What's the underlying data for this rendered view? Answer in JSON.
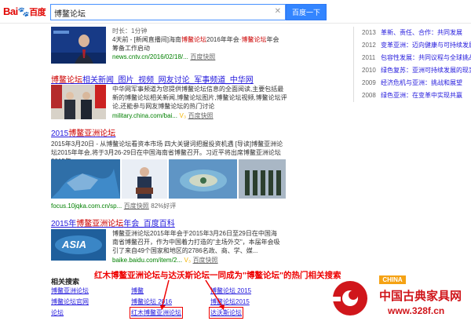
{
  "header": {
    "logo_text_bai": "Bai",
    "logo_text_du": "百度",
    "search_value": "博鳌论坛",
    "search_button": "百度一下"
  },
  "results": [
    {
      "meta_line": "时长：1分钟",
      "abstract_prefix": "4天前 - [新闻直播间]海南",
      "abstract_hl1": "博鳌论坛",
      "abstract_mid": "2016年年会·",
      "abstract_hl2": "博鳌论坛",
      "abstract_suffix": "年会筹备工作启动",
      "url": "news.cntv.cn/2016/02/18/...",
      "snapshot": "百度快照"
    },
    {
      "title_hl": "博鳌论坛",
      "title_rest": "相关新闻_图片_视频_网友讨论_军事频道_中华网",
      "abstract": "中华网军事频道为您提供博鳌论坛信息的全面阅读,主要包括最新的博鳌论坛相关新闻,博鳌论坛图片,博鳌论坛视频,博鳌论坛评论,还能参与网友博鳌论坛的热门讨论",
      "url": "military.china.com/bai...",
      "snapshot": "百度快照"
    },
    {
      "title_pre": "2015",
      "title_hl": "博鳌亚洲论坛",
      "abstract": "2015年3月20日 - 从博鳌论坛看资本市场 四大关键词把握投资机遇 [导读]博鳌亚洲论坛2015年年会,将于3月26-29日在中国海南省博鳌召开。习近平将出席博鳌亚洲论坛2015年...",
      "url": "focus.10jqka.com.cn/sp...",
      "snapshot": "百度快照",
      "rating": "82%好评"
    },
    {
      "title_pre": "2015年",
      "title_hl": "博鳌亚洲论坛",
      "title_rest": "年会_百度百科",
      "abstract": "博鳌亚洲论坛2015年年会于2015年3月26日至29日在中国海南省博鳌召开，作为中国着力打造的\"主场外交\"，本届年会吸引了来自49个国家和地区的2786名政、商、学、媒...",
      "url": "baike.baidu.com/item/2...",
      "snapshot": "百度快照",
      "thumb_text": "ASIA"
    }
  ],
  "timeline": [
    {
      "year": "2013",
      "title": "革新、责任、合作：共同发展"
    },
    {
      "year": "2012",
      "title": "变革亚洲：迈向健康与可持续发展"
    },
    {
      "year": "2011",
      "title": "包容性发展：共同议程与全球挑战"
    },
    {
      "year": "2010",
      "title": "绿色复苏：亚洲可持续发展的现实选择"
    },
    {
      "year": "2009",
      "title": "经济危机与亚洲：挑战和展望"
    },
    {
      "year": "2008",
      "title": "绿色亚洲：在变革中实现共赢"
    }
  ],
  "related": {
    "title": "相关搜索",
    "col1": [
      "博鳌亚洲论坛",
      "博鳌论坛官网",
      "论坛"
    ],
    "col2": [
      "博鳌",
      "博鳌论坛 2016",
      "红木博鳌亚洲论坛"
    ],
    "col3": [
      "博鳌论坛 2015",
      "博鳌论坛2015",
      "达沃斯论坛"
    ]
  },
  "annotation": "红木博鳌亚洲论坛与达沃斯论坛一同成为\"博鳌论坛\"的热门相关搜索",
  "watermark": {
    "badge": "CHINA",
    "name": "中国古典家具网",
    "url": "www.328f.cn"
  },
  "colors": {
    "link": "#2319dc",
    "highlight": "#cc0000",
    "url_green": "#008000",
    "accent_blue": "#3385ff",
    "annotation_red": "#e00000"
  }
}
